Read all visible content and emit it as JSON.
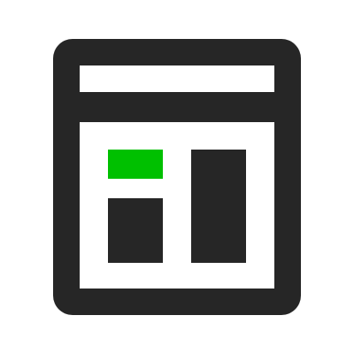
{
  "icon": {
    "name": "dashboard-layout-icon",
    "colors": {
      "frame": "#262626",
      "background": "#ffffff",
      "accent": "#00c000",
      "block": "#262626"
    }
  }
}
